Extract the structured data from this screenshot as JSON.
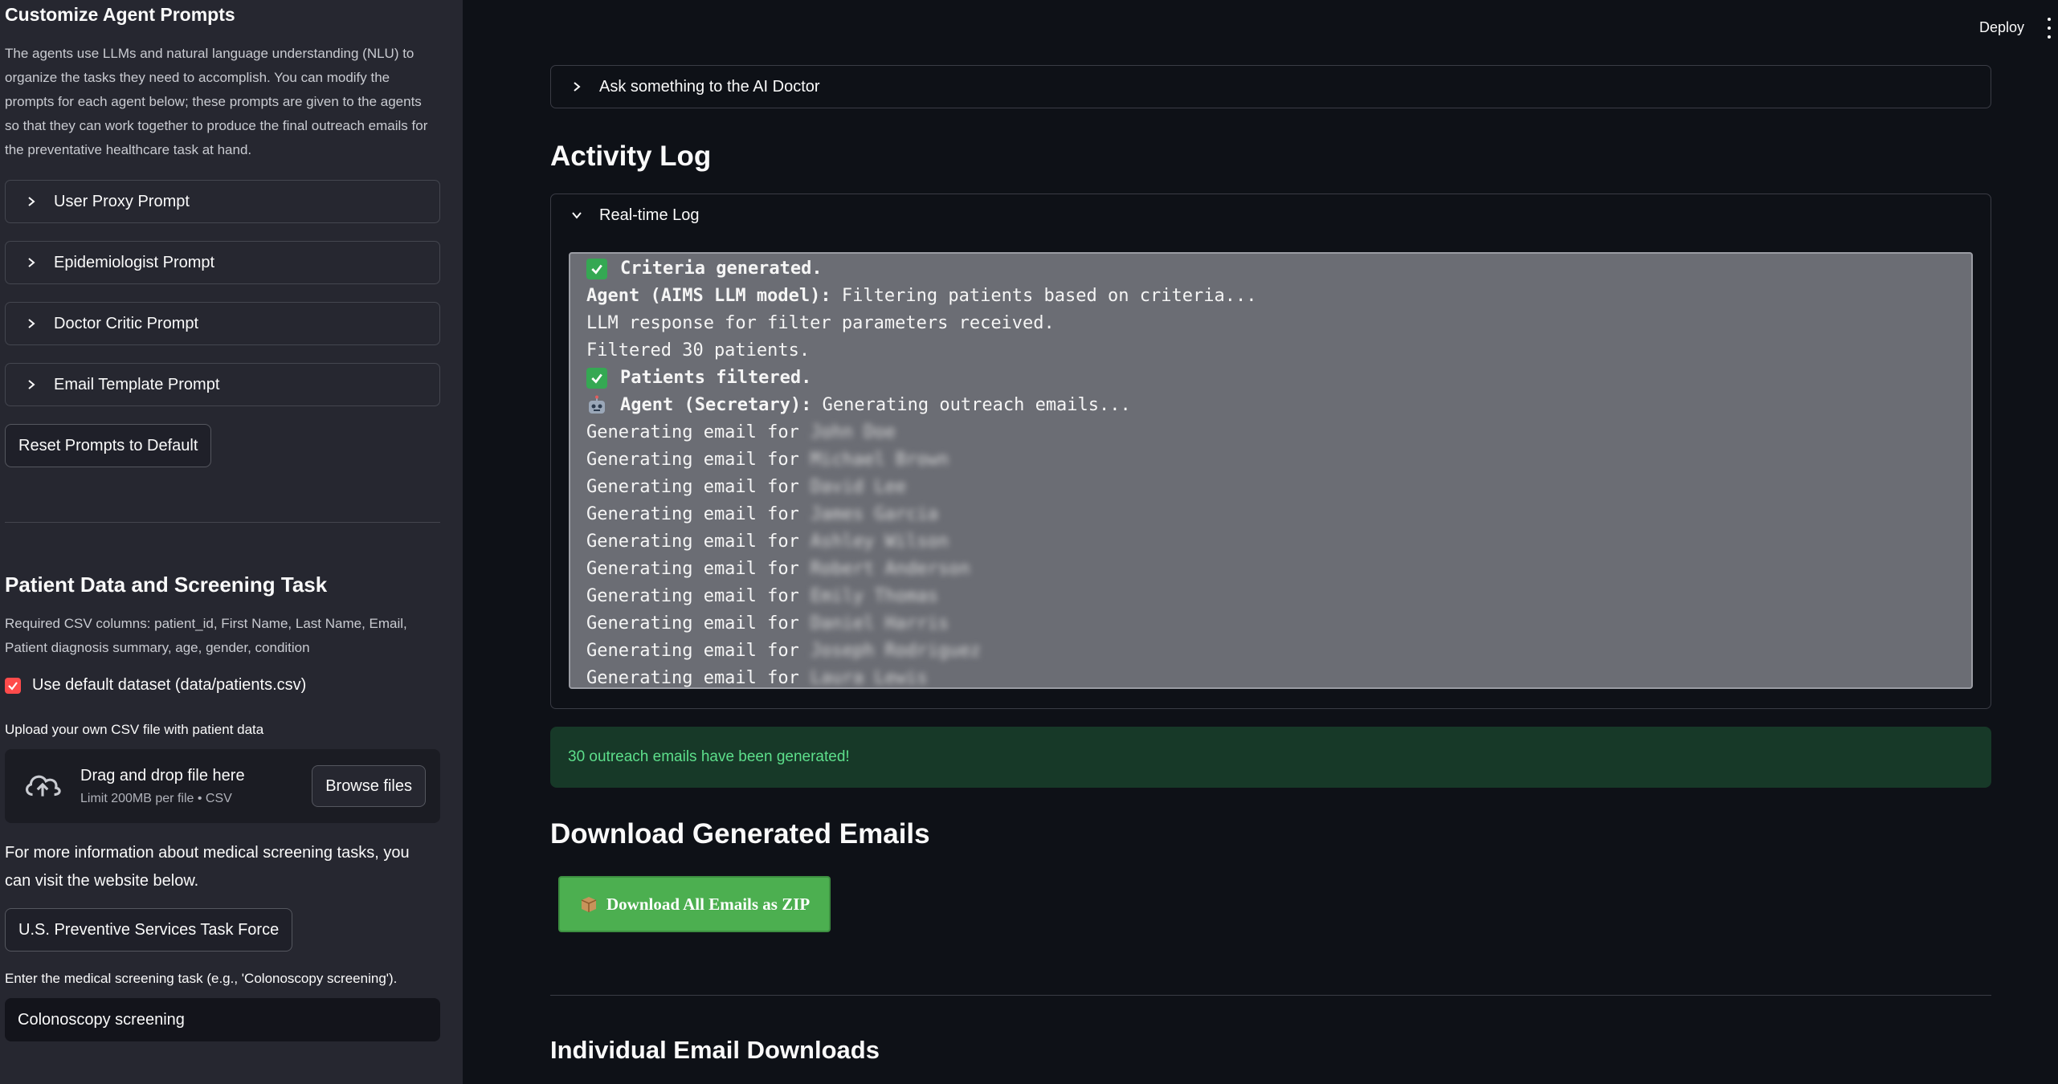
{
  "sidebar": {
    "title": "Customize Agent Prompts",
    "description": "The agents use LLMs and natural language understanding (NLU) to organize the tasks they need to accomplish. You can modify the prompts for each agent below; these prompts are given to the agents so that they can work together to produce the final outreach emails for the preventative healthcare task at hand.",
    "prompt_expanders": [
      {
        "label": "User Proxy Prompt"
      },
      {
        "label": "Epidemiologist Prompt"
      },
      {
        "label": "Doctor Critic Prompt"
      },
      {
        "label": "Email Template Prompt"
      }
    ],
    "reset_button": "Reset Prompts to Default",
    "patient_section_title": "Patient Data and Screening Task",
    "required_columns": "Required CSV columns: patient_id, First Name, Last Name, Email, Patient diagnosis summary, age, gender, condition",
    "default_dataset_label": "Use default dataset (data/patients.csv)",
    "default_dataset_checked": true,
    "upload_label": "Upload your own CSV file with patient data",
    "uploader_main": "Drag and drop file here",
    "uploader_sub": "Limit 200MB per file • CSV",
    "browse_button": "Browse files",
    "more_info_text": "For more information about medical screening tasks, you can visit the website below.",
    "uspstf_button": "U.S. Preventive Services Task Force",
    "task_label": "Enter the medical screening task (e.g., 'Colonoscopy screening').",
    "task_value": "Colonoscopy screening"
  },
  "topbar": {
    "deploy": "Deploy"
  },
  "main": {
    "ask_expander": "Ask something to the AI Doctor",
    "activity_log_title": "Activity Log",
    "realtime_log_expander": "Real-time Log",
    "log": {
      "line1_bold": "Criteria generated.",
      "line2_bold": "Agent (AIMS LLM model):",
      "line2_rest": " Filtering patients based on criteria...",
      "line3": "LLM response for filter parameters received.",
      "line4": "Filtered 30 patients.",
      "line5_bold": "Patients filtered.",
      "line6_bold": "Agent (Secretary):",
      "line6_rest": " Generating outreach emails...",
      "email_prefix": "Generating email for",
      "email_names": [
        "John Doe",
        "Michael Brown",
        "David Lee",
        "James Garcia",
        "Ashley Wilson",
        "Robert Anderson",
        "Emily Thomas",
        "Daniel Harris",
        "Joseph Rodriguez",
        "Laura Lewis"
      ]
    },
    "success_message": "30 outreach emails have been generated!",
    "download_title": "Download Generated Emails",
    "zip_button": "Download All Emails as ZIP",
    "individual_title": "Individual Email Downloads"
  },
  "colors": {
    "sidebar_bg": "#262730",
    "main_bg": "#0e1117",
    "accent_red": "#ff4b4b",
    "success_green": "#5ddf8b",
    "zip_button_green": "#4caf50"
  }
}
